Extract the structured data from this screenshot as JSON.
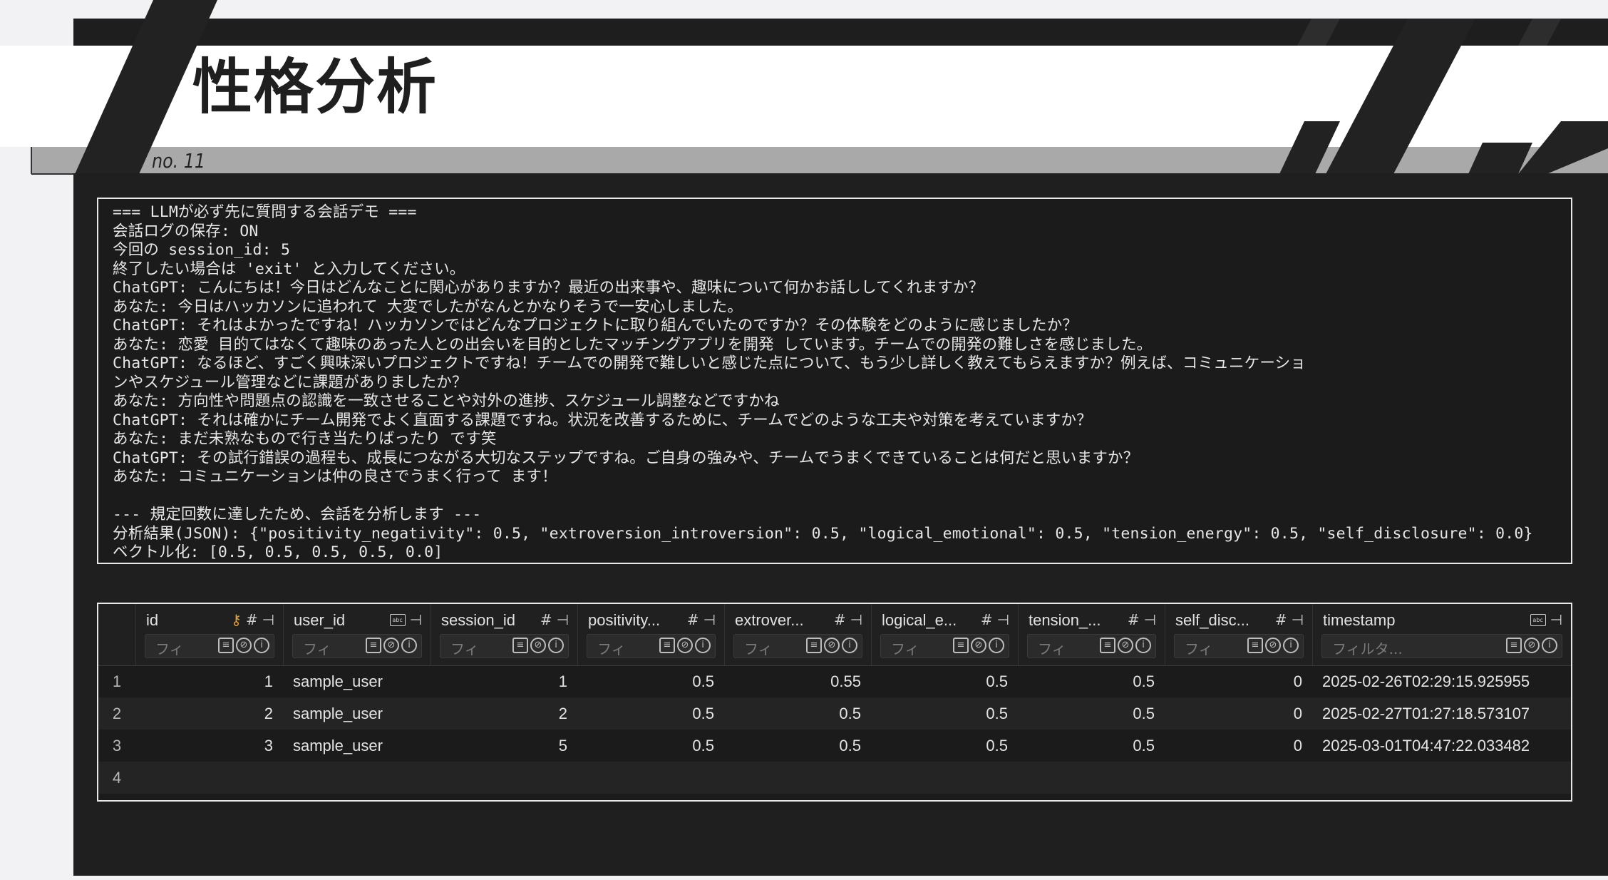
{
  "slide": {
    "title": "性格分析",
    "number": "no. 11"
  },
  "terminal": {
    "lines": [
      "=== LLMが必ず先に質問する会話デモ ===",
      "会話ログの保存: ON",
      "今回の session_id: 5",
      "終了したい場合は 'exit' と入力してください。",
      "ChatGPT: こんにちは！今日はどんなことに関心がありますか？最近の出来事や、趣味について何かお話ししてくれますか？",
      "あなた: 今日はハッカソンに追われて 大変でしたがなんとかなりそうで一安心しました。",
      "ChatGPT: それはよかったですね！ハッカソンではどんなプロジェクトに取り組んでいたのですか？その体験をどのように感じましたか？",
      "あなた: 恋愛 目的てはなくて趣味のあった人との出会いを目的としたマッチングアプリを開発 しています。チームでの開発の難しさを感じました。",
      "ChatGPT: なるほど、すごく興味深いプロジェクトですね！チームでの開発で難しいと感じた点について、もう少し詳しく教えてもらえますか？例えば、コミュニケーショ",
      "ンやスケジュール管理などに課題がありましたか？",
      "あなた: 方向性や問題点の認識を一致させることや対外の進捗、スケジュール調整などですかね",
      "ChatGPT: それは確かにチーム開発でよく直面する課題ですね。状況を改善するために、チームでどのような工夫や対策を考えていますか？",
      "あなた: まだ未熟なもので行き当たりばったり です笑",
      "ChatGPT: その試行錯誤の過程も、成長につながる大切なステップですね。ご自身の強みや、チームでうまくできていることは何だと思いますか？",
      "あなた: コミュニケーションは仲の良さでうまく行って ます！",
      "",
      "--- 規定回数に達したため、会話を分析します ---",
      "分析結果(JSON): {\"positivity_negativity\": 0.5, \"extroversion_introversion\": 0.5, \"logical_emotional\": 0.5, \"tension_energy\": 0.5, \"self_disclosure\": 0.0}",
      "ベクトル化: [0.5, 0.5, 0.5, 0.5, 0.0]"
    ]
  },
  "table": {
    "columns": [
      {
        "name": "id",
        "type_icon": "key-hash",
        "filter_placeholder": "フィ"
      },
      {
        "name": "user_id",
        "type_icon": "abc",
        "filter_placeholder": "フィ"
      },
      {
        "name": "session_id",
        "type_icon": "hash",
        "filter_placeholder": "フィ"
      },
      {
        "name": "positivity...",
        "type_icon": "hash",
        "filter_placeholder": "フィ"
      },
      {
        "name": "extrover...",
        "type_icon": "hash",
        "filter_placeholder": "フィ"
      },
      {
        "name": "logical_e...",
        "type_icon": "hash",
        "filter_placeholder": "フィ"
      },
      {
        "name": "tension_...",
        "type_icon": "hash",
        "filter_placeholder": "フィ"
      },
      {
        "name": "self_disc...",
        "type_icon": "hash",
        "filter_placeholder": "フィ"
      },
      {
        "name": "timestamp",
        "type_icon": "abc",
        "filter_placeholder": "フィルタ..."
      }
    ],
    "rows": [
      {
        "num": "1",
        "cells": [
          "1",
          "sample_user",
          "1",
          "0.5",
          "0.55",
          "0.5",
          "0.5",
          "0",
          "2025-02-26T02:29:15.925955"
        ]
      },
      {
        "num": "2",
        "cells": [
          "2",
          "sample_user",
          "2",
          "0.5",
          "0.5",
          "0.5",
          "0.5",
          "0",
          "2025-02-27T01:27:18.573107"
        ]
      },
      {
        "num": "3",
        "cells": [
          "3",
          "sample_user",
          "5",
          "0.5",
          "0.5",
          "0.5",
          "0.5",
          "0",
          "2025-03-01T04:47:22.033482"
        ]
      },
      {
        "num": "4",
        "cells": [
          "",
          "",
          "",
          "",
          "",
          "",
          "",
          "",
          ""
        ]
      }
    ]
  },
  "colors": {
    "panel": "#1f1f1f",
    "title_band": "#ffffff",
    "grey_band": "#a9a9a9",
    "key_icon": "#e0a23b"
  }
}
